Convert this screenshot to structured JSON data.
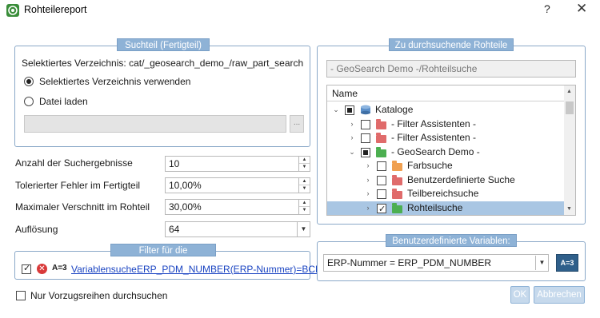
{
  "window": {
    "title": "Rohteilereport",
    "help_label": "?",
    "close_label": "✕"
  },
  "suchteil": {
    "legend": "Suchteil (Fertigteil)",
    "selected_dir_label": "Selektiertes Verzeichnis: cat/_geosearch_demo_/raw_part_search",
    "option_use_dir": "Selektiertes Verzeichnis verwenden",
    "option_load_file": "Datei laden",
    "file_path_value": "",
    "browse_label": "..."
  },
  "params": {
    "results_count": {
      "label": "Anzahl der Suchergebnisse",
      "value": "10"
    },
    "tolerance": {
      "label": "Tolerierter Fehler im Fertigteil",
      "value": "10,00%"
    },
    "waste": {
      "label": "Maximaler Verschnitt im Rohteil",
      "value": "30,00%"
    },
    "resolution": {
      "label": "Auflösung",
      "value": "64"
    }
  },
  "filter": {
    "legend": "Filter für die Ergebnisse:",
    "item": {
      "badge": "A=3",
      "link1": "Variablensuche",
      "link2": "ERP_PDM_NUMBER(ERP-Nummer)=BCD",
      "checked": true
    }
  },
  "preferred_only_label": "Nur Vorzugsreihen durchsuchen",
  "rohteile": {
    "legend": "Zu durchsuchende Rohteile",
    "selected_path": "- GeoSearch Demo -/Rohteilsuche",
    "column_header": "Name",
    "tree": [
      {
        "label": "Kataloge",
        "icon": "catalog-icon",
        "expanded": true,
        "check": "partial",
        "depth": 0
      },
      {
        "label": "- Filter Assistenten -",
        "icon": "folder-icon",
        "color": "#e06b6b",
        "expanded": false,
        "check": "off",
        "depth": 1
      },
      {
        "label": "- Filter Assistenten -",
        "icon": "folder-icon",
        "color": "#e06b6b",
        "expanded": false,
        "check": "off",
        "depth": 1
      },
      {
        "label": "- GeoSearch Demo -",
        "icon": "folder-icon",
        "color": "#4caf50",
        "expanded": true,
        "check": "partial",
        "depth": 1
      },
      {
        "label": "Farbsuche",
        "icon": "folder-icon",
        "color": "#f0a050",
        "expanded": false,
        "check": "off",
        "depth": 2
      },
      {
        "label": "Benutzerdefinierte Suche",
        "icon": "folder-icon",
        "color": "#e06b6b",
        "expanded": false,
        "check": "off",
        "depth": 2
      },
      {
        "label": "Teilbereichsuche",
        "icon": "folder-icon",
        "color": "#e06b6b",
        "expanded": false,
        "check": "off",
        "depth": 2
      },
      {
        "label": "Rohteilsuche",
        "icon": "folder-icon",
        "color": "#4caf50",
        "expanded": false,
        "check": "on",
        "depth": 2,
        "selected": true
      }
    ]
  },
  "variables": {
    "legend": "Benutzerdefinierte Variablen:",
    "selected": "ERP-Nummer = ERP_PDM_NUMBER",
    "badge": "A=3"
  },
  "buttons": {
    "ok": "OK",
    "cancel": "Abbrechen"
  },
  "colors": {
    "accent": "#8eb2d6",
    "selection": "#a9c6e3",
    "link": "#1a44c2"
  }
}
